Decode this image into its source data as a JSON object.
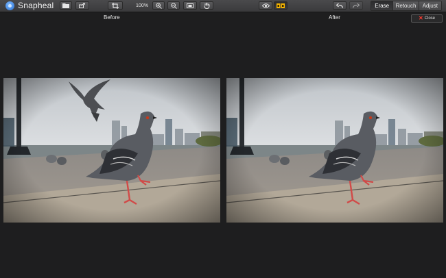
{
  "app": {
    "title": "Snapheal"
  },
  "toolbar": {
    "zoom": "100%",
    "modes": [
      "Erase",
      "Retouch",
      "Adjust"
    ],
    "active_mode": "Erase"
  },
  "panels": {
    "before_label": "Before",
    "after_label": "After"
  },
  "close": {
    "label": "Close"
  },
  "icons": [
    "folder-icon",
    "share-icon",
    "crop-icon",
    "zoom-in-icon",
    "zoom-out-icon",
    "fit-icon",
    "hand-icon",
    "eye-icon",
    "split-view-icon",
    "undo-icon",
    "redo-icon",
    "close-icon"
  ],
  "colors": {
    "toolbar": "#404042",
    "background": "#1e1e1f",
    "close_x": "#ff3b30",
    "split_active": "#f5b400"
  }
}
